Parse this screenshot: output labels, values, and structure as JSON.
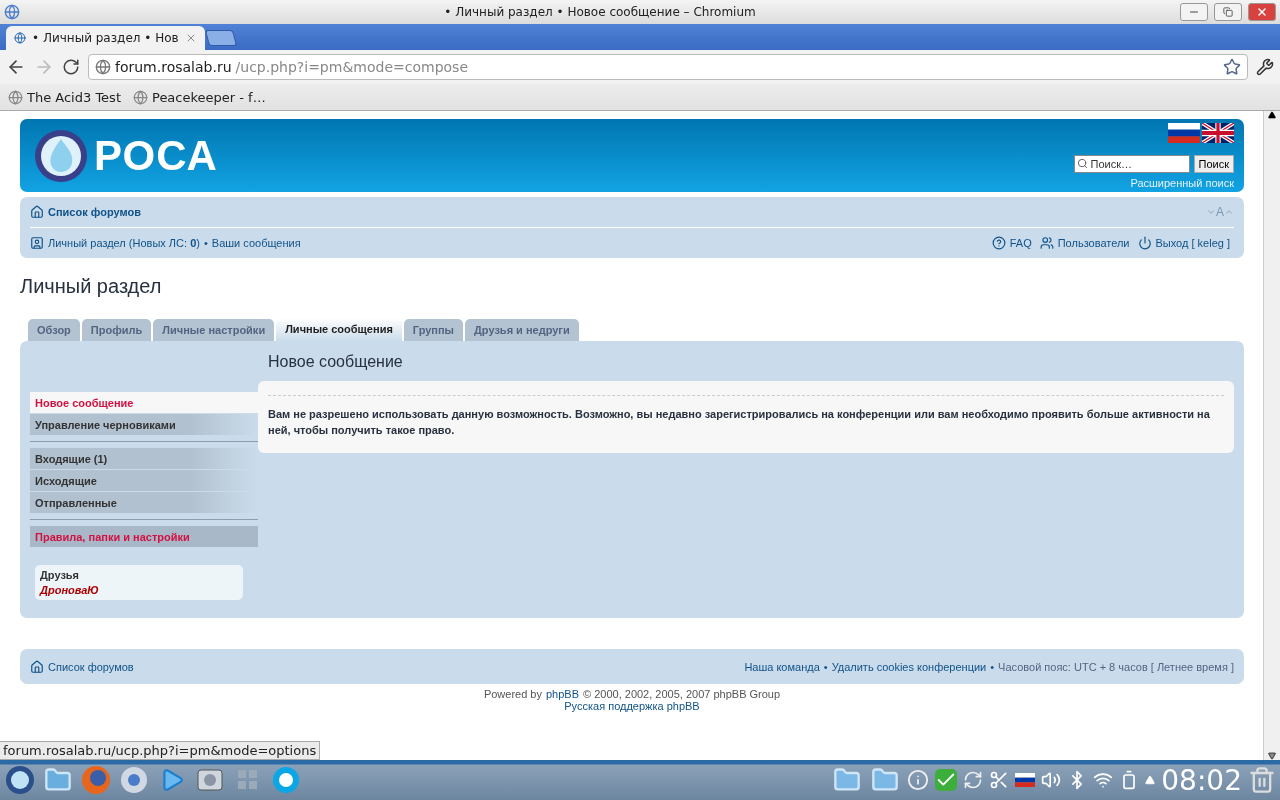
{
  "window": {
    "title": "• Личный раздел • Новое сообщение – Chromium"
  },
  "browser": {
    "tabs": [
      {
        "title": "• Личный раздел • Нов",
        "selected": true
      }
    ],
    "address": {
      "host": "forum.rosalab.ru",
      "path": "/ucp.php?i=pm&mode=compose"
    },
    "back_enabled": true,
    "forward_enabled": false,
    "bookmarks": [
      "The Acid3 Test",
      "Peacekeeper - f…"
    ]
  },
  "page": {
    "logo": "РОСА",
    "search": {
      "placeholder": "Поиск…",
      "button": "Поиск",
      "advanced": "Расширенный поиск"
    },
    "breadcrumb": "Список форумов",
    "font_size_label": "A",
    "separator": "•",
    "user_links": [
      {
        "kind": "ucp",
        "text": "Личный раздел (Новых ЛС: **0**)"
      },
      {
        "kind": "posts",
        "text": "Ваши сообщения"
      }
    ],
    "right_links": [
      {
        "kind": "faq",
        "text": "FAQ"
      },
      {
        "kind": "members",
        "text": "Пользователи"
      },
      {
        "kind": "logout",
        "text": "Выход [ keleg ]"
      }
    ],
    "heading": "Личный раздел",
    "tabs": [
      {
        "label": "Обзор",
        "selected": false
      },
      {
        "label": "Профиль",
        "selected": false
      },
      {
        "label": "Личные настройки",
        "selected": false
      },
      {
        "label": "Личные сообщения",
        "selected": true
      },
      {
        "label": "Группы",
        "selected": false
      },
      {
        "label": "Друзья и недруги",
        "selected": false
      }
    ],
    "menu_groups": [
      [
        {
          "label": "Новое сообщение",
          "kind": "item",
          "selected": true
        },
        {
          "label": "Управление черновиками",
          "kind": "item",
          "selected": false
        }
      ],
      [
        {
          "label": "Входящие (1)",
          "kind": "item",
          "selected": false
        },
        {
          "label": "Исходящие",
          "kind": "item",
          "selected": false
        },
        {
          "label": "Отправленные",
          "kind": "item",
          "selected": false
        }
      ],
      [
        {
          "label": "Правила, папки и настройки",
          "kind": "link",
          "selected": false
        }
      ]
    ],
    "friends": {
      "title": "Друзья",
      "names": [
        "ДроноваЮ"
      ]
    },
    "panel_title": "Новое сообщение",
    "message": "Вам не разрешено использовать данную возможность. Возможно, вы недавно зарегистрировались на конференции или вам необходимо проявить больше активности на ней, чтобы получить такое право.",
    "footer": {
      "breadcrumb": "Список форумов",
      "links": [
        "Наша команда",
        "Удалить cookies конференции"
      ],
      "timezone": "Часовой пояс: UTC + 8 часов [ Летнее время ]"
    },
    "copyright": {
      "prefix": "Powered by",
      "link": "phpBB",
      "suffix": "© 2000, 2002, 2005, 2007 phpBB Group",
      "support": "Русская поддержка phpBB"
    }
  },
  "status_url": "forum.rosalab.ru/ucp.php?i=pm&mode=options",
  "taskbar": {
    "clock": "08:02"
  }
}
